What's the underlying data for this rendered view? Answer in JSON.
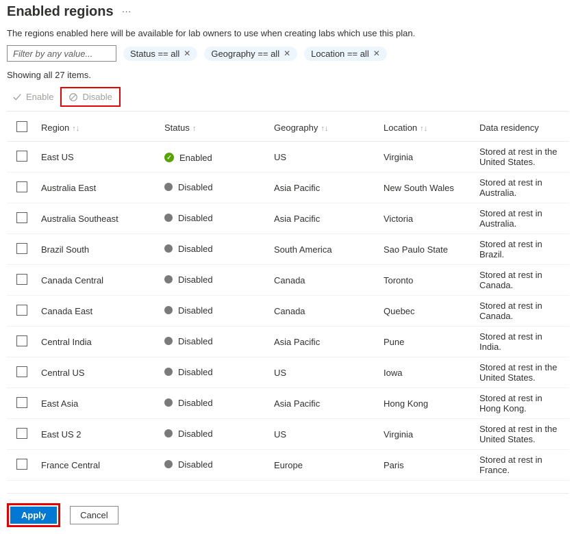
{
  "header": {
    "title": "Enabled regions"
  },
  "description": "The regions enabled here will be available for lab owners to use when creating labs which use this plan.",
  "filter": {
    "placeholder": "Filter by any value...",
    "pills": [
      {
        "label": "Status == all"
      },
      {
        "label": "Geography == all"
      },
      {
        "label": "Location == all"
      }
    ]
  },
  "showing": "Showing all 27 items.",
  "actions": {
    "enable": "Enable",
    "disable": "Disable"
  },
  "table": {
    "columns": {
      "region": "Region",
      "status": "Status",
      "geography": "Geography",
      "location": "Location",
      "residency": "Data residency"
    },
    "rows": [
      {
        "region": "East US",
        "status": "Enabled",
        "enabled": true,
        "geography": "US",
        "location": "Virginia",
        "residency": "Stored at rest in the United States."
      },
      {
        "region": "Australia East",
        "status": "Disabled",
        "enabled": false,
        "geography": "Asia Pacific",
        "location": "New South Wales",
        "residency": "Stored at rest in Australia."
      },
      {
        "region": "Australia Southeast",
        "status": "Disabled",
        "enabled": false,
        "geography": "Asia Pacific",
        "location": "Victoria",
        "residency": "Stored at rest in Australia."
      },
      {
        "region": "Brazil South",
        "status": "Disabled",
        "enabled": false,
        "geography": "South America",
        "location": "Sao Paulo State",
        "residency": "Stored at rest in Brazil."
      },
      {
        "region": "Canada Central",
        "status": "Disabled",
        "enabled": false,
        "geography": "Canada",
        "location": "Toronto",
        "residency": "Stored at rest in Canada."
      },
      {
        "region": "Canada East",
        "status": "Disabled",
        "enabled": false,
        "geography": "Canada",
        "location": "Quebec",
        "residency": "Stored at rest in Canada."
      },
      {
        "region": "Central India",
        "status": "Disabled",
        "enabled": false,
        "geography": "Asia Pacific",
        "location": "Pune",
        "residency": "Stored at rest in India."
      },
      {
        "region": "Central US",
        "status": "Disabled",
        "enabled": false,
        "geography": "US",
        "location": "Iowa",
        "residency": "Stored at rest in the United States."
      },
      {
        "region": "East Asia",
        "status": "Disabled",
        "enabled": false,
        "geography": "Asia Pacific",
        "location": "Hong Kong",
        "residency": "Stored at rest in Hong Kong."
      },
      {
        "region": "East US 2",
        "status": "Disabled",
        "enabled": false,
        "geography": "US",
        "location": "Virginia",
        "residency": "Stored at rest in the United States."
      },
      {
        "region": "France Central",
        "status": "Disabled",
        "enabled": false,
        "geography": "Europe",
        "location": "Paris",
        "residency": "Stored at rest in France."
      }
    ]
  },
  "footer": {
    "apply": "Apply",
    "cancel": "Cancel"
  }
}
